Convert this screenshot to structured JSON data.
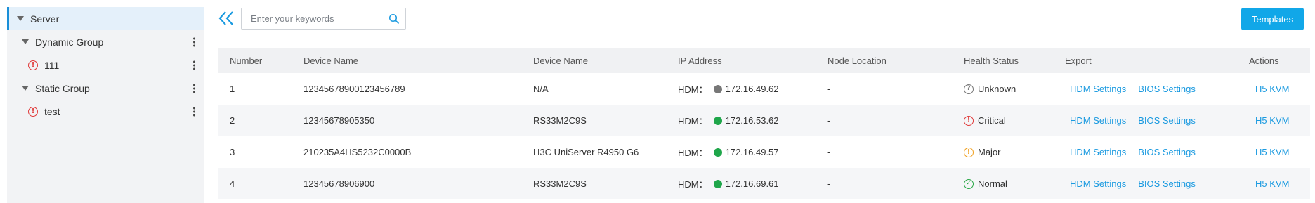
{
  "sidebar": {
    "items": [
      {
        "label": "Server",
        "level": 0,
        "selected": true,
        "has_caret": true,
        "has_menu": false
      },
      {
        "label": "Dynamic Group",
        "level": 1,
        "has_caret": true,
        "has_menu": true
      },
      {
        "label": "111",
        "level": 2,
        "status_icon": "critical",
        "has_menu": true
      },
      {
        "label": "Static Group",
        "level": 1,
        "has_caret": true,
        "has_menu": true
      },
      {
        "label": "test",
        "level": 2,
        "status_icon": "critical",
        "has_menu": true
      }
    ]
  },
  "toolbar": {
    "search_placeholder": "Enter your keywords",
    "search_value": "",
    "templates_label": "Templates"
  },
  "table": {
    "headers": {
      "number": "Number",
      "device_name_1": "Device Name",
      "device_name_2": "Device Name",
      "ip_address": "IP Address",
      "node_location": "Node Location",
      "health_status": "Health Status",
      "export": "Export",
      "actions": "Actions"
    },
    "rows": [
      {
        "number": "1",
        "device_name_1": "12345678900123456789",
        "device_name_2": "N/A",
        "ip_prefix": "HDM：",
        "ip_status": "offline",
        "ip": "172.16.49.62",
        "node_location": "-",
        "health_icon": "unknown",
        "health": "Unknown",
        "export_hdm": "HDM Settings",
        "export_bios": "BIOS Settings",
        "action": "H5 KVM"
      },
      {
        "number": "2",
        "device_name_1": "12345678905350",
        "device_name_2": "RS33M2C9S",
        "ip_prefix": "HDM：",
        "ip_status": "online",
        "ip": "172.16.53.62",
        "node_location": "-",
        "health_icon": "critical",
        "health": "Critical",
        "export_hdm": "HDM Settings",
        "export_bios": "BIOS Settings",
        "action": "H5 KVM"
      },
      {
        "number": "3",
        "device_name_1": "210235A4HS5232C0000B",
        "device_name_2": "H3C UniServer R4950 G6",
        "ip_prefix": "HDM：",
        "ip_status": "online",
        "ip": "172.16.49.57",
        "node_location": "-",
        "health_icon": "major",
        "health": "Major",
        "export_hdm": "HDM Settings",
        "export_bios": "BIOS Settings",
        "action": "H5 KVM"
      },
      {
        "number": "4",
        "device_name_1": "12345678906900",
        "device_name_2": "RS33M2C9S",
        "ip_prefix": "HDM：",
        "ip_status": "online",
        "ip": "172.16.69.61",
        "node_location": "-",
        "health_icon": "normal",
        "health": "Normal",
        "export_hdm": "HDM Settings",
        "export_bios": "BIOS Settings",
        "action": "H5 KVM"
      }
    ]
  },
  "colors": {
    "accent": "#11a7e8",
    "link": "#1a9ae0",
    "online_dot": "#1fa64a",
    "offline_dot": "#777777",
    "critical": "#e03a3a",
    "major": "#f0a020",
    "normal": "#28a745"
  },
  "icons": {
    "collapse": "double-chevron-left-icon",
    "search": "search-icon",
    "menu": "kebab-menu-icon",
    "tree_caret": "caret-down-icon"
  }
}
